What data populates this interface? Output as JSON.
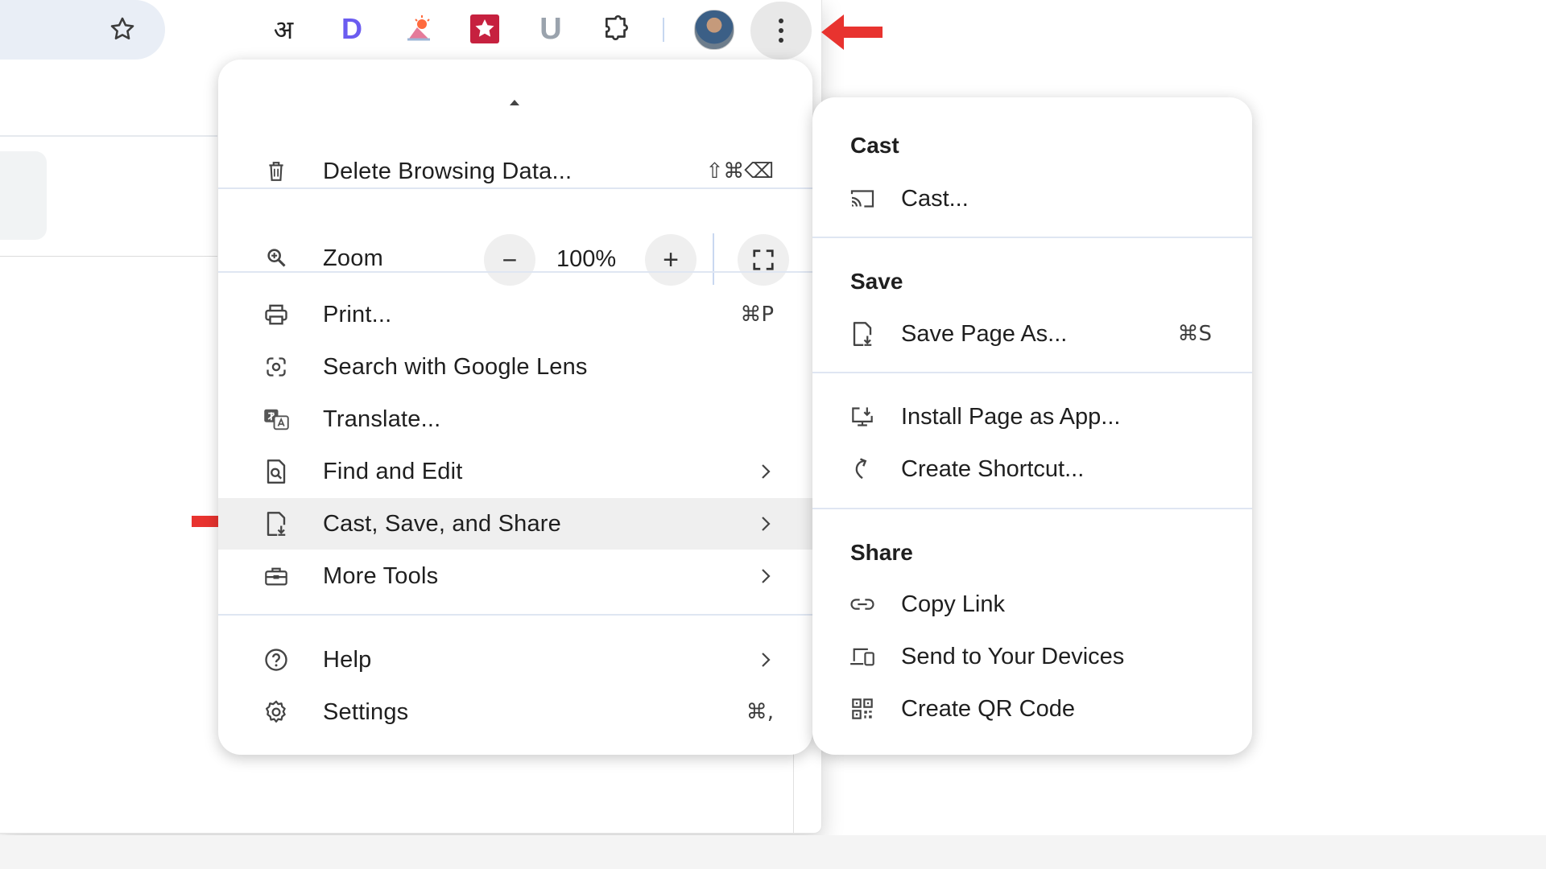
{
  "toolbar": {
    "icons": [
      "hindi-extension-icon",
      "d-extension-icon",
      "weather-extension-icon",
      "star-extension-icon",
      "u-extension-icon",
      "extensions-puzzle-icon"
    ],
    "hindi_glyph": "अ",
    "d_letter": "D",
    "u_letter": "U"
  },
  "main_menu": {
    "delete_browsing_data": {
      "label": "Delete Browsing Data...",
      "shortcut": "⇧⌘⌫"
    },
    "zoom": {
      "label": "Zoom",
      "minus": "−",
      "value": "100%",
      "plus": "+"
    },
    "print": {
      "label": "Print...",
      "shortcut": "⌘P"
    },
    "search_lens": {
      "label": "Search with Google Lens"
    },
    "translate": {
      "label": "Translate..."
    },
    "find_edit": {
      "label": "Find and Edit"
    },
    "cast_save_share": {
      "label": "Cast, Save, and Share"
    },
    "more_tools": {
      "label": "More Tools"
    },
    "help": {
      "label": "Help"
    },
    "settings": {
      "label": "Settings",
      "shortcut": "⌘,"
    }
  },
  "sub_menu": {
    "cast_heading": "Cast",
    "cast": {
      "label": "Cast..."
    },
    "save_heading": "Save",
    "save_page_as": {
      "label": "Save Page As...",
      "shortcut": "⌘S"
    },
    "install_page_as_app": {
      "label": "Install Page as App..."
    },
    "create_shortcut": {
      "label": "Create Shortcut..."
    },
    "share_heading": "Share",
    "copy_link": {
      "label": "Copy Link"
    },
    "send_to_devices": {
      "label": "Send to Your Devices"
    },
    "create_qr_code": {
      "label": "Create QR Code"
    }
  },
  "colors": {
    "annotation_arrow": "#e8332f",
    "menu_bg": "#ffffff",
    "highlight": "#efefef",
    "separator": "#dfe6f2"
  }
}
